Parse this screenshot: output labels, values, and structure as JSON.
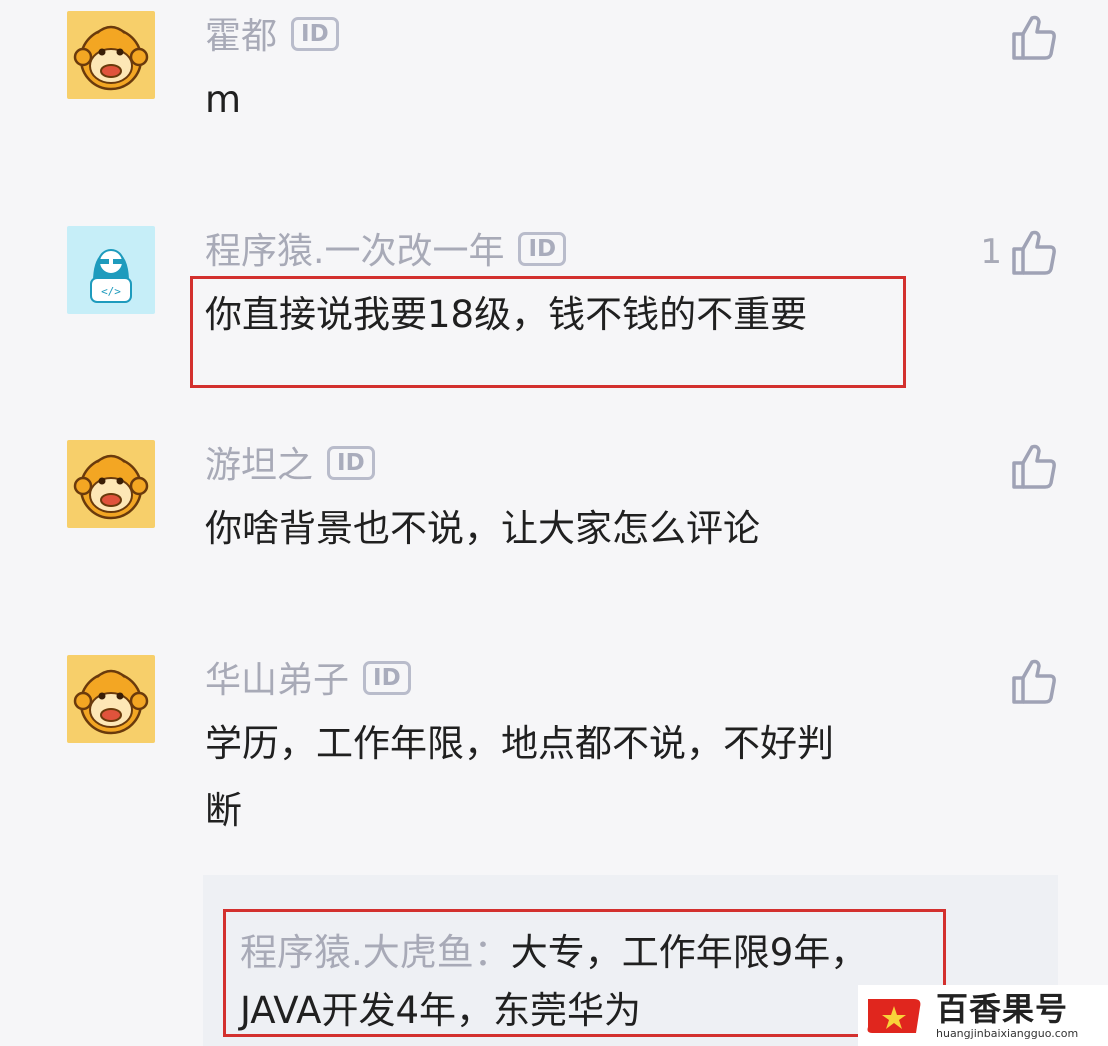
{
  "comments": [
    {
      "username": "霍都",
      "badge": "ID",
      "text": "m",
      "likes": "",
      "avatar": "monkey-avatar"
    },
    {
      "username": "程序猿.一次改一年",
      "badge": "ID",
      "text": "你直接说我要18级，钱不钱的不重要",
      "likes": "1",
      "avatar": "coder-avatar"
    },
    {
      "username": "游坦之",
      "badge": "ID",
      "text": "你啥背景也不说，让大家怎么评论",
      "likes": "",
      "avatar": "monkey-avatar"
    },
    {
      "username": "华山弟子",
      "badge": "ID",
      "text_line1": "学历，工作年限，地点都不说，不好判",
      "text_line2": "断",
      "likes": "",
      "avatar": "monkey-avatar"
    }
  ],
  "reply": {
    "name": "程序猿.大虎鱼：",
    "text_line1": "大专，工作年限9年，",
    "text_line2": "JAVA开发4年，东莞华为"
  },
  "watermark": {
    "title": "百香果号",
    "subtitle": "huangjinbaixiangguo.com"
  },
  "colors": {
    "highlight": "#d3302e",
    "username": "#a8aab7",
    "background": "#f6f6f8",
    "avatar_yellow": "#f7cf6a",
    "avatar_cyan": "#c6eef8"
  },
  "icons": {
    "like": "thumbs-up-icon",
    "badge": "id-badge-icon",
    "watermark_logo": "red-flag-star-icon"
  }
}
